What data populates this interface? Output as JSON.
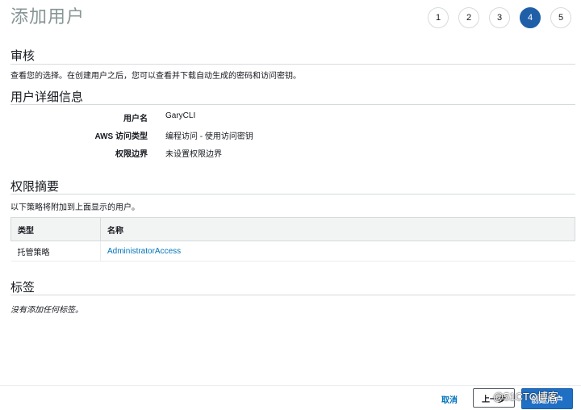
{
  "header": {
    "title": "添加用户",
    "steps": [
      {
        "label": "1",
        "active": false
      },
      {
        "label": "2",
        "active": false
      },
      {
        "label": "3",
        "active": false
      },
      {
        "label": "4",
        "active": true
      },
      {
        "label": "5",
        "active": false
      }
    ]
  },
  "review": {
    "title": "审核",
    "description": "查看您的选择。在创建用户之后，您可以查看并下载自动生成的密码和访问密钥。"
  },
  "user_details": {
    "title": "用户详细信息",
    "rows": [
      {
        "label": "用户名",
        "value": "GaryCLI"
      },
      {
        "label": "AWS 访问类型",
        "value": "编程访问 - 使用访问密钥"
      },
      {
        "label": "权限边界",
        "value": "未设置权限边界"
      }
    ]
  },
  "permissions": {
    "title": "权限摘要",
    "description": "以下策略将附加到上面显示的用户。",
    "columns": [
      "类型",
      "名称"
    ],
    "rows": [
      {
        "type": "托管策略",
        "name": "AdministratorAccess"
      }
    ]
  },
  "tags": {
    "title": "标签",
    "empty_text": "没有添加任何标签。"
  },
  "footer": {
    "cancel_label": "取消",
    "previous_label": "上一步",
    "create_label": "创建用户",
    "watermark": "@51CTO博客"
  },
  "colors": {
    "accent": "#1f5fa8",
    "link": "#0073bb",
    "title_gray": "#879596"
  }
}
